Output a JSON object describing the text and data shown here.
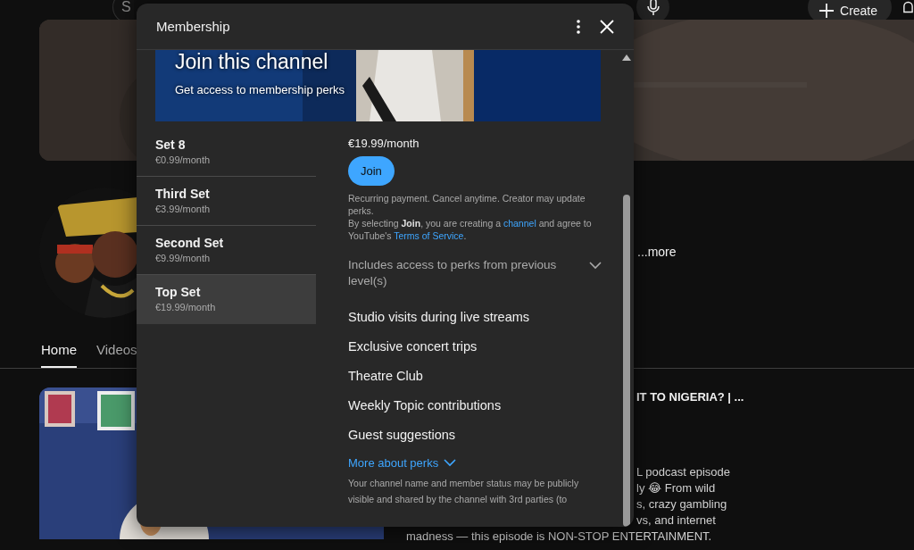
{
  "topbar": {
    "search": {
      "placeholder": "S"
    },
    "create_button": "Create"
  },
  "channel": {
    "more_link": "...more"
  },
  "tabs": [
    {
      "label": "Home",
      "selected": true
    },
    {
      "label": "Videos",
      "selected": false
    }
  ],
  "video": {
    "title": "IT TO NIGERIA? | ...",
    "description_lines": [
      "L podcast episode",
      "ly 😂 From wild",
      "s, crazy gambling",
      "vs, and internet",
      "madness — this episode is NON-STOP ENTERTAINMENT."
    ]
  },
  "dialog": {
    "title": "Membership",
    "hero": {
      "title": "Join this channel",
      "subtitle": "Get access to membership perks"
    },
    "levels": [
      {
        "name": "Set 8",
        "price": "€0.99/month",
        "selected": false
      },
      {
        "name": "Third Set",
        "price": "€3.99/month",
        "selected": false
      },
      {
        "name": "Second Set",
        "price": "€9.99/month",
        "selected": false
      },
      {
        "name": "Top Set",
        "price": "€19.99/month",
        "selected": true
      }
    ],
    "detail": {
      "price": "€19.99/month",
      "join_button": "Join",
      "notice": "Recurring payment. Cancel anytime. Creator may update perks.",
      "consent": {
        "before": "By selecting **Join**, you are creating a ",
        "channel_link": "channel",
        "middle": " and agree to YouTube's ",
        "terms_link": "Terms of Service",
        "after": "."
      },
      "includes": {
        "label": "Includes access to perks from previous level(s)",
        "expanded": false
      },
      "perks": [
        "Studio visits during live streams",
        "Exclusive concert trips",
        "Theatre Club",
        "Weekly Topic contributions",
        "Guest suggestions"
      ],
      "more_perks": {
        "label": "More about perks",
        "expanded": false
      },
      "disclaimer": "Your channel name and member status may be publicly visible and shared by the channel with 3rd parties (to"
    }
  }
}
